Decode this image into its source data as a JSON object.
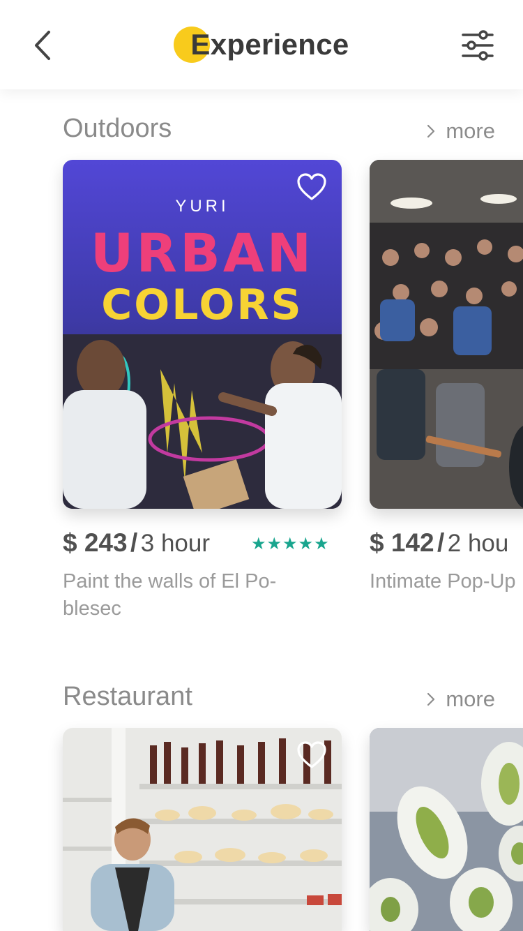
{
  "header": {
    "title": "Experience"
  },
  "sections": [
    {
      "title": "Outdoors",
      "more": "more",
      "cards": [
        {
          "poster_brand": "YURI",
          "poster_line1": "URBAN",
          "poster_line2": "COLORS",
          "price": "$ 243",
          "sep": "/",
          "duration": "3 hour",
          "rating": 5,
          "stars": "★★★★★",
          "desc_line1": "Paint the walls of El Po-",
          "desc_line2": "blesec"
        },
        {
          "price": "$ 142",
          "sep": "/",
          "duration": "2 hou",
          "desc_line1": "Intimate Pop-Up"
        }
      ]
    },
    {
      "title": "Restaurant",
      "more": "more",
      "cards": [
        {},
        {}
      ]
    }
  ],
  "colors": {
    "accent": "#f8cb1c",
    "stars": "#19a58e",
    "poster_bg": "#4a3fd0",
    "poster_pink": "#ee3f7a",
    "poster_yellow": "#f7d334"
  },
  "icons": [
    "back-chevron-icon",
    "filter-sliders-icon",
    "heart-icon",
    "chevron-right-icon",
    "star-icon"
  ]
}
